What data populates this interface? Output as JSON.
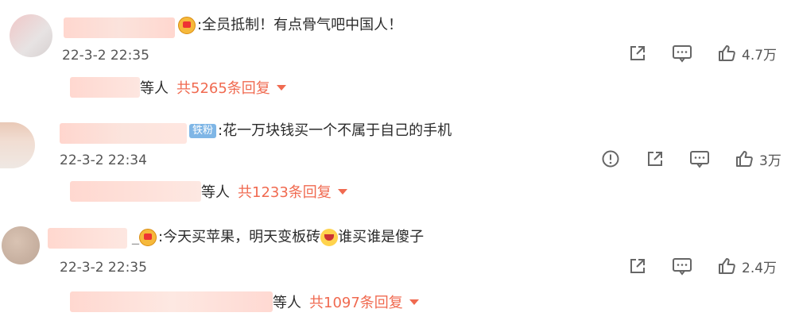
{
  "comments": [
    {
      "text": "全员抵制！有点骨气吧中国人！",
      "time": "22-3-2 22:35",
      "likes": "4.7万",
      "reply_suffix": "等人",
      "reply_count": "共5265条回复",
      "badge": "crown"
    },
    {
      "text": "花一万块钱买一个不属于自己的手机",
      "time": "22-3-2 22:34",
      "likes": "3万",
      "reply_suffix": "等人",
      "reply_count": "共1233条回复",
      "badge": "iron",
      "badge_label": "铁粉"
    },
    {
      "text_before": "今天买苹果，明天变板砖",
      "text_after": "谁买谁是傻子",
      "time": "22-3-2 22:35",
      "likes": "2.4万",
      "reply_suffix": "等人",
      "reply_count": "共1097条回复",
      "badge": "crown"
    }
  ],
  "colors": {
    "accent": "#f06a50",
    "badge_blue": "#7fb6e6",
    "crown": "#f6b93b"
  }
}
